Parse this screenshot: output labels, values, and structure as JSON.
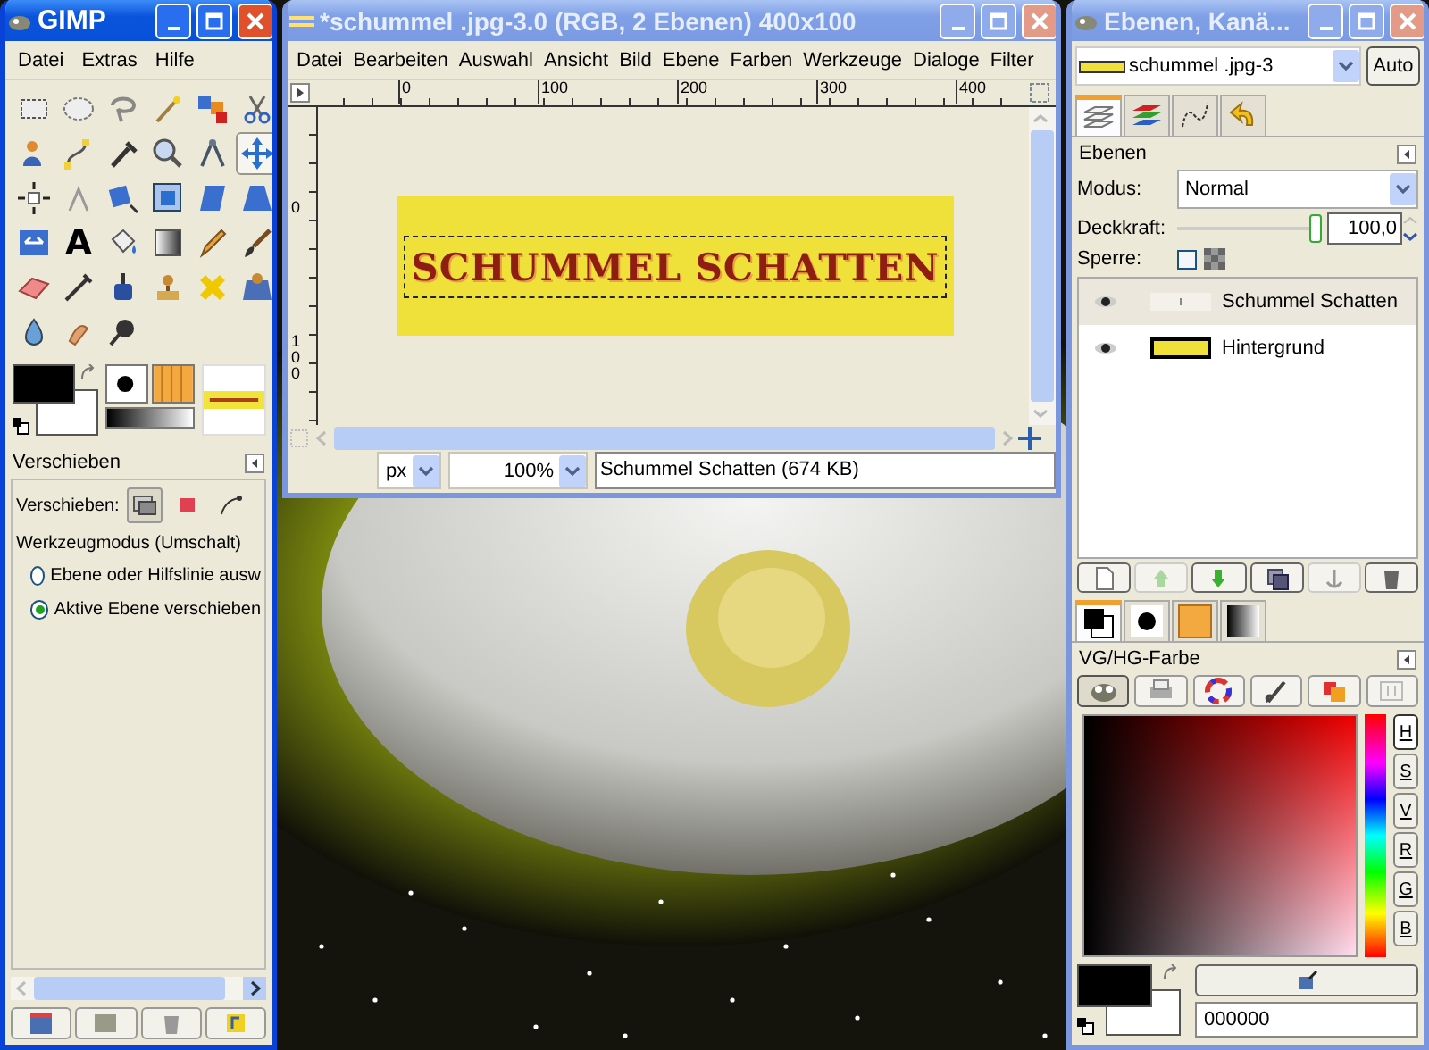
{
  "toolbox": {
    "title": "GIMP",
    "active": true,
    "menu": [
      "Datei",
      "Extras",
      "Hilfe"
    ],
    "tools": [
      {
        "kind": "rect",
        "selected": false
      },
      {
        "kind": "ellipse",
        "selected": false
      },
      {
        "kind": "lasso",
        "selected": false
      },
      {
        "kind": "wand",
        "selected": false
      },
      {
        "kind": "colorsel",
        "selected": false
      },
      {
        "kind": "scissors",
        "selected": false
      },
      {
        "kind": "figure",
        "selected": false
      },
      {
        "kind": "path",
        "selected": false
      },
      {
        "kind": "picker",
        "selected": false
      },
      {
        "kind": "zoom",
        "selected": false
      },
      {
        "kind": "compass",
        "selected": false
      },
      {
        "kind": "move",
        "selected": true
      },
      {
        "kind": "align",
        "selected": false
      },
      {
        "kind": "crop",
        "selected": false
      },
      {
        "kind": "rotate",
        "selected": false
      },
      {
        "kind": "scale",
        "selected": false
      },
      {
        "kind": "shear",
        "selected": false
      },
      {
        "kind": "perspective",
        "selected": false
      },
      {
        "kind": "flip",
        "selected": false
      },
      {
        "kind": "text",
        "glyph": "A",
        "selected": false
      },
      {
        "kind": "bucket",
        "selected": false
      },
      {
        "kind": "blend",
        "selected": false
      },
      {
        "kind": "pencil",
        "selected": false
      },
      {
        "kind": "brush",
        "selected": false
      },
      {
        "kind": "eraser",
        "selected": false
      },
      {
        "kind": "airbrush",
        "selected": false
      },
      {
        "kind": "ink",
        "selected": false
      },
      {
        "kind": "clone",
        "selected": false
      },
      {
        "kind": "heal",
        "selected": false
      },
      {
        "kind": "pclone",
        "selected": false
      },
      {
        "kind": "blur",
        "selected": false
      },
      {
        "kind": "smudge",
        "selected": false
      },
      {
        "kind": "dodge",
        "selected": false
      }
    ],
    "tool_options": {
      "title": "Verschieben",
      "move_label": "Verschieben:",
      "move_modes": [
        {
          "kind": "layer",
          "selected": true
        },
        {
          "kind": "selection",
          "selected": false
        },
        {
          "kind": "path",
          "selected": false
        }
      ],
      "mode_label": "Werkzeugmodus (Umschalt)",
      "options": [
        {
          "label": "Ebene oder Hilfslinie ausw",
          "selected": false
        },
        {
          "label": "Aktive Ebene verschieben",
          "selected": true
        }
      ]
    }
  },
  "image_window": {
    "title": "*schummel .jpg-3.0 (RGB, 2 Ebenen) 400x100",
    "active": false,
    "menu": [
      "Datei",
      "Bearbeiten",
      "Auswahl",
      "Ansicht",
      "Bild",
      "Ebene",
      "Farben",
      "Werkzeuge",
      "Dialoge",
      "Filter"
    ],
    "ruler_ticks": [
      "0",
      "100",
      "200",
      "300",
      "400"
    ],
    "vruler_ticks": [
      "0",
      "100"
    ],
    "canvas_text": "SCHUMMEL SCHATTEN",
    "unit": "px",
    "zoom": "100%",
    "status": "Schummel  Schatten (674 KB)"
  },
  "layers_window": {
    "title": "Ebenen, Kanä...",
    "active": false,
    "image": "schummel .jpg-3",
    "auto": "Auto",
    "tabs": [
      {
        "kind": "layers",
        "selected": true
      },
      {
        "kind": "channels",
        "selected": false
      },
      {
        "kind": "paths",
        "selected": false
      },
      {
        "kind": "undo",
        "selected": false
      }
    ],
    "panel_title": "Ebenen",
    "mode_label": "Modus:",
    "mode": "Normal",
    "opacity_label": "Deckkraft:",
    "opacity": {
      "level": 1.0
    },
    "opacity_value": "100,0",
    "lock_label": "Sperre:",
    "lock_checked": false,
    "layers": [
      {
        "name": "Schummel  Schatten",
        "kind": "text",
        "visible": true,
        "selected": true
      },
      {
        "name": "Hintergrund",
        "kind": "fill",
        "visible": true,
        "selected": false
      }
    ],
    "color_tabs": [
      {
        "kind": "fgbg",
        "selected": true
      },
      {
        "kind": "brush",
        "selected": false
      },
      {
        "kind": "pattern",
        "selected": false
      },
      {
        "kind": "gradient",
        "selected": false
      }
    ],
    "color_title": "VG/HG-Farbe",
    "selectors": [
      {
        "kind": "creature",
        "selected": true
      },
      {
        "kind": "printer",
        "selected": false
      },
      {
        "kind": "wheel",
        "selected": false
      },
      {
        "kind": "watercolor",
        "selected": false
      },
      {
        "kind": "swatch",
        "selected": false
      },
      {
        "kind": "scales",
        "selected": false
      }
    ],
    "channels": [
      {
        "label": "H",
        "selected": true
      },
      {
        "label": "S",
        "selected": false
      },
      {
        "label": "V",
        "selected": false
      },
      {
        "label": "R",
        "selected": false
      },
      {
        "label": "G",
        "selected": false
      },
      {
        "label": "B",
        "selected": false
      }
    ],
    "hex": "000000"
  }
}
